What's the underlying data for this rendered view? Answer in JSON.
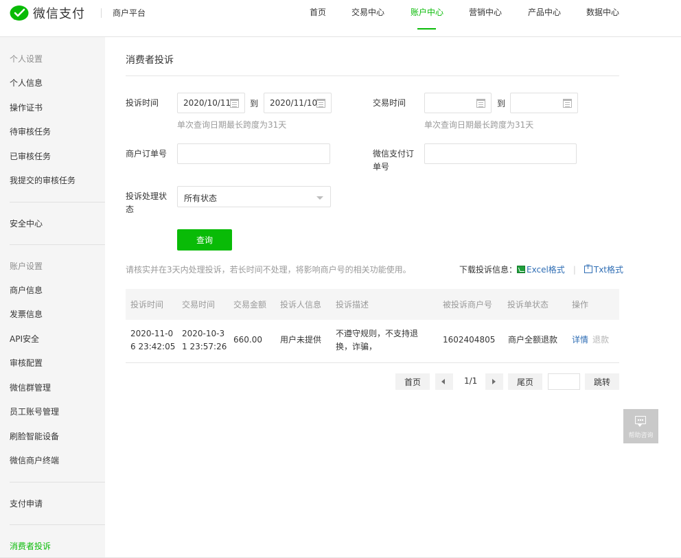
{
  "header": {
    "logo_text": "微信支付",
    "platform": "商户平台",
    "logo_icon": "wechat-pay-logo",
    "nav": [
      {
        "label": "首页",
        "active": false
      },
      {
        "label": "交易中心",
        "active": false
      },
      {
        "label": "账户中心",
        "active": true
      },
      {
        "label": "营销中心",
        "active": false
      },
      {
        "label": "产品中心",
        "active": false
      },
      {
        "label": "数据中心",
        "active": false
      }
    ]
  },
  "sidebar": {
    "group_personal": "个人设置",
    "personal_items": [
      "个人信息",
      "操作证书",
      "待审核任务",
      "已审核任务",
      "我提交的审核任务"
    ],
    "security": "安全中心",
    "group_account": "账户设置",
    "account_items": [
      "商户信息",
      "发票信息",
      "API安全",
      "审核配置",
      "微信群管理",
      "员工账号管理",
      "刷脸智能设备",
      "微信商户终端"
    ],
    "payment_apply": "支付申请",
    "consumer_complaint": "消费者投诉",
    "active_item": "消费者投诉"
  },
  "main": {
    "title": "消费者投诉",
    "filters": {
      "complaint_time_label": "投诉时间",
      "complaint_time_from": "2020/10/11",
      "complaint_time_to": "2020/11/10",
      "to_label": "到",
      "complaint_time_hint": "单次查询日期最长跨度为31天",
      "trade_time_label": "交易时间",
      "trade_time_from": "",
      "trade_time_to": "",
      "trade_time_hint": "单次查询日期最长跨度为31天",
      "order_no_label": "商户订单号",
      "order_no_value": "",
      "wx_order_label_line1": "微信支付订",
      "wx_order_label_line2": "单号",
      "wx_order_value": "",
      "status_label_line1": "投诉处理状",
      "status_label_line2": "态",
      "status_selected": "所有状态",
      "query_button": "查询"
    },
    "notice": "请核实并在3天内处理投诉，若长时间不处理，将影响商户号的相关功能使用。",
    "download": {
      "label": "下载投诉信息：",
      "excel": "Excel格式",
      "sep": "|",
      "txt": "Txt格式"
    },
    "table": {
      "columns": [
        "投诉时间",
        "交易时间",
        "交易金额",
        "投诉人信息",
        "投诉描述",
        "被投诉商户号",
        "投诉单状态",
        "操作"
      ],
      "rows": [
        {
          "complaint_time_line1": "2020-11-0",
          "complaint_time_line2": "6 23:42:05",
          "trade_time_line1": "2020-10-3",
          "trade_time_line2": "1 23:57:26",
          "amount": "660.00",
          "complainant": "用户未提供",
          "desc_line1": "不遵守规则，不支持退",
          "desc_line2": "换，诈骗，",
          "merchant_no": "1602404805",
          "status": "商户全额退款",
          "action_detail": "详情",
          "action_refund": "退款"
        }
      ]
    },
    "pagination": {
      "first": "首页",
      "info": "1/1",
      "last": "尾页",
      "jump_value": "",
      "jump": "跳转"
    }
  },
  "float_feedback": {
    "icon": "chat-icon",
    "text": "帮助咨询"
  },
  "colors": {
    "accent": "#09bb07",
    "link": "#2e6db4",
    "muted": "#9a9a9a"
  }
}
